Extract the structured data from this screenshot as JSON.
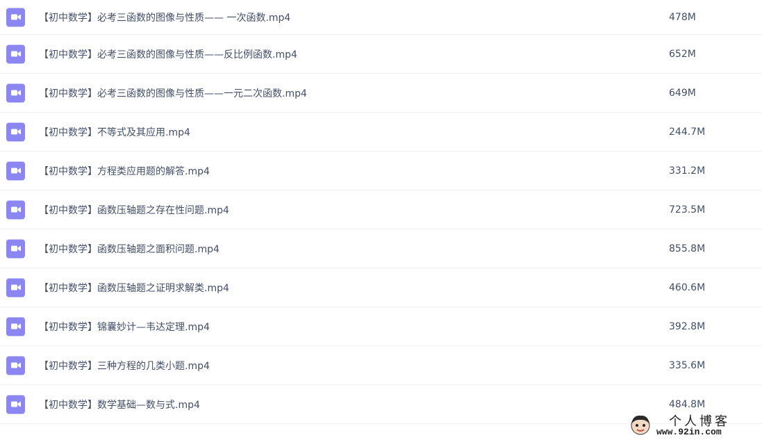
{
  "files": [
    {
      "name": "【初中数学】必考三函数的图像与性质—— 一次函数.mp4",
      "size": "478M",
      "icon": "video-icon"
    },
    {
      "name": "【初中数学】必考三函数的图像与性质——反比例函数.mp4",
      "size": "652M",
      "icon": "video-icon"
    },
    {
      "name": "【初中数学】必考三函数的图像与性质——一元二次函数.mp4",
      "size": "649M",
      "icon": "video-icon"
    },
    {
      "name": "【初中数学】不等式及其应用.mp4",
      "size": "244.7M",
      "icon": "video-icon"
    },
    {
      "name": "【初中数学】方程类应用题的解答.mp4",
      "size": "331.2M",
      "icon": "video-icon"
    },
    {
      "name": "【初中数学】函数压轴题之存在性问题.mp4",
      "size": "723.5M",
      "icon": "video-icon"
    },
    {
      "name": "【初中数学】函数压轴题之面积问题.mp4",
      "size": "855.8M",
      "icon": "video-icon"
    },
    {
      "name": "【初中数学】函数压轴题之证明求解类.mp4",
      "size": "460.6M",
      "icon": "video-icon"
    },
    {
      "name": "【初中数学】锦囊妙计—韦达定理.mp4",
      "size": "392.8M",
      "icon": "video-icon"
    },
    {
      "name": "【初中数学】三种方程的几类小题.mp4",
      "size": "335.6M",
      "icon": "video-icon"
    },
    {
      "name": "【初中数学】数学基础—数与式.mp4",
      "size": "484.8M",
      "icon": "video-icon"
    }
  ],
  "watermark": {
    "title": "个人博客",
    "url": "www.92in.com"
  },
  "colors": {
    "icon_bg": "#8b86f2",
    "text": "#424e67",
    "divider": "#eef0f4"
  }
}
